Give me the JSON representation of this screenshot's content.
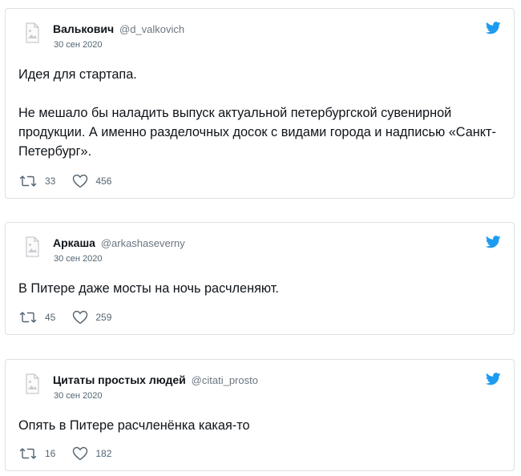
{
  "colors": {
    "twitter_blue": "#1d9bf0",
    "text": "#0f1419",
    "muted": "#536471",
    "border": "#dcdfe3"
  },
  "icons": {
    "brand": "twitter-bird-icon",
    "avatar": "broken-image-icon",
    "retweet": "retweet-icon",
    "like": "heart-icon"
  },
  "tweets": [
    {
      "display_name": "Валькович",
      "handle": "@d_valkovich",
      "date": "30 сен 2020",
      "paragraphs": [
        "Идея для стартапа.",
        "Не мешало бы наладить выпуск актуальной петербургской сувенирной продукции. А именно разделочных досок с видами города и надписью «Санкт-Петербург»."
      ],
      "retweets": "33",
      "likes": "456"
    },
    {
      "display_name": "Аркаша",
      "handle": "@arkashaseverny",
      "date": "30 сен 2020",
      "paragraphs": [
        "В Питере даже мосты на ночь расчленяют."
      ],
      "retweets": "45",
      "likes": "259"
    },
    {
      "display_name": "Цитаты простых людей",
      "handle": "@citati_prosto",
      "date": "30 сен 2020",
      "paragraphs": [
        "Опять в Питере расчленёнка какая-то"
      ],
      "retweets": "16",
      "likes": "182"
    }
  ]
}
